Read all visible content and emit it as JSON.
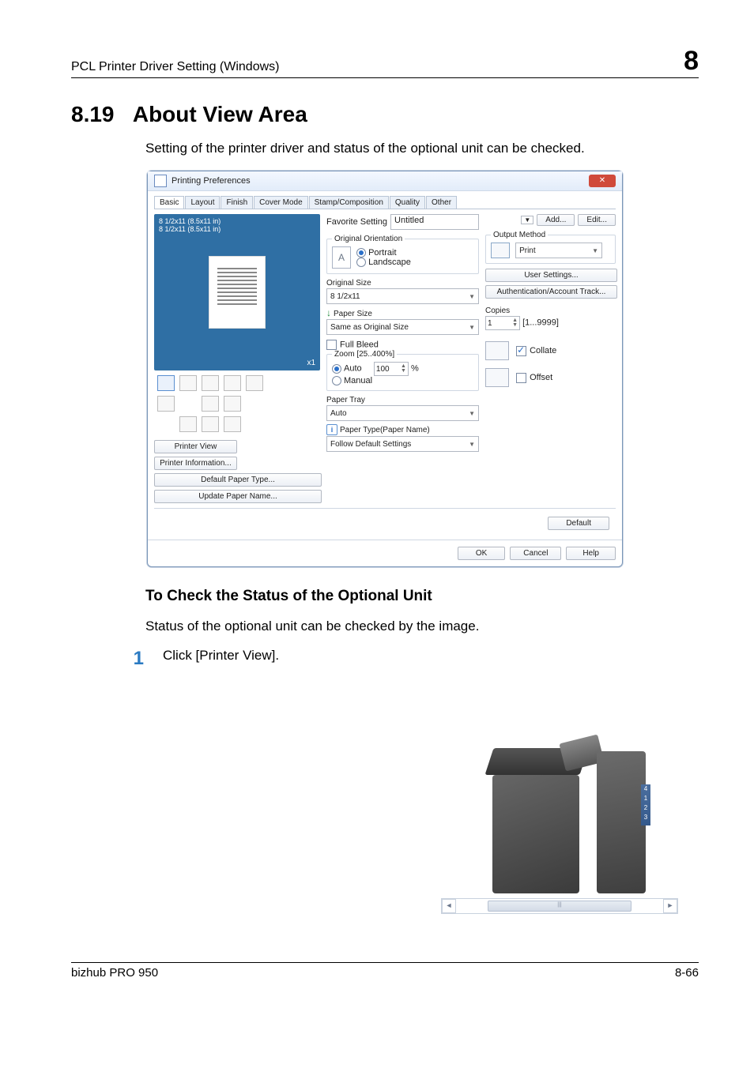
{
  "running_header": {
    "left": "PCL Printer Driver Setting (Windows)",
    "right": "8"
  },
  "section": {
    "number": "8.19",
    "title": "About View Area",
    "intro": "Setting of the printer driver and status of the optional unit can be checked."
  },
  "dialog": {
    "title": "Printing Preferences",
    "tabs": [
      "Basic",
      "Layout",
      "Finish",
      "Cover Mode",
      "Stamp/Composition",
      "Quality",
      "Other"
    ],
    "active_tab": "Basic",
    "preview": {
      "line1": "8 1/2x11 (8.5x11 in)",
      "line2": "8 1/2x11 (8.5x11 in)",
      "corner": "x1"
    },
    "left_buttons": {
      "printer_view": "Printer View",
      "printer_info": "Printer Information...",
      "default_paper_type": "Default Paper Type...",
      "update_paper_name": "Update Paper Name..."
    },
    "favorite": {
      "label": "Favorite Setting",
      "value": "Untitled",
      "add": "Add...",
      "edit": "Edit..."
    },
    "orientation": {
      "legend": "Original Orientation",
      "portrait": "Portrait",
      "landscape": "Landscape"
    },
    "original_size": {
      "label": "Original Size",
      "value": "8 1/2x11"
    },
    "paper_size": {
      "label": "Paper Size",
      "value": "Same as Original Size"
    },
    "full_bleed": {
      "label": "Full Bleed"
    },
    "zoom": {
      "legend": "Zoom [25..400%]",
      "auto": "Auto",
      "manual": "Manual",
      "value": "100",
      "percent": "%"
    },
    "paper_tray": {
      "label": "Paper Tray",
      "value": "Auto"
    },
    "paper_type": {
      "label": "Paper Type(Paper Name)",
      "value": "Follow Default Settings"
    },
    "output_method": {
      "legend": "Output Method",
      "value": "Print"
    },
    "user_settings": "User Settings...",
    "auth_track": "Authentication/Account Track...",
    "copies": {
      "label": "Copies",
      "value": "1",
      "range": "[1...9999]"
    },
    "collate": "Collate",
    "offset": "Offset",
    "default": "Default",
    "footer": {
      "ok": "OK",
      "cancel": "Cancel",
      "help": "Help"
    }
  },
  "subsection": {
    "heading": "To Check the Status of the Optional Unit",
    "desc": "Status of the optional unit can be checked by the image.",
    "step_num": "1",
    "step_text": "Click [Printer View]."
  },
  "device_tags": {
    "t1": "1",
    "t2": "2",
    "t3": "3",
    "t4": "4"
  },
  "scrollbar_glyph": "|||",
  "footer": {
    "left": "bizhub PRO 950",
    "right": "8-66"
  }
}
